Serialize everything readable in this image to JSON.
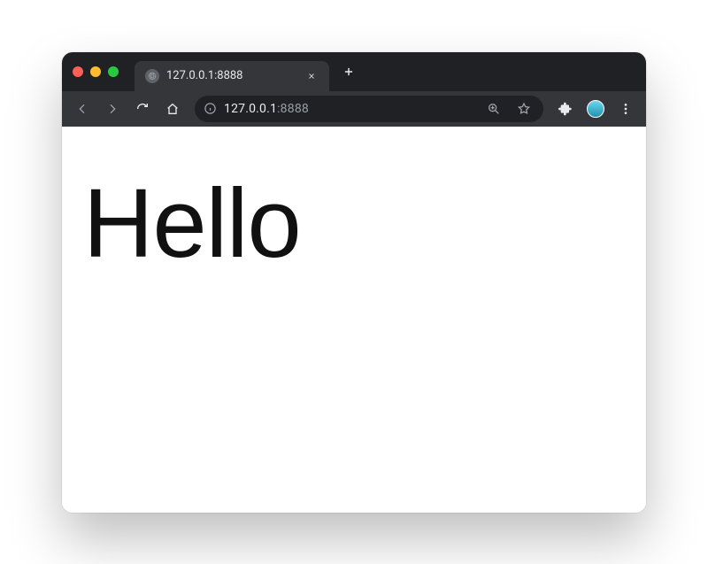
{
  "tab": {
    "title": "127.0.0.1:8888"
  },
  "omnibox": {
    "host": "127.0.0.1",
    "port": ":8888"
  },
  "page": {
    "heading": "Hello"
  }
}
